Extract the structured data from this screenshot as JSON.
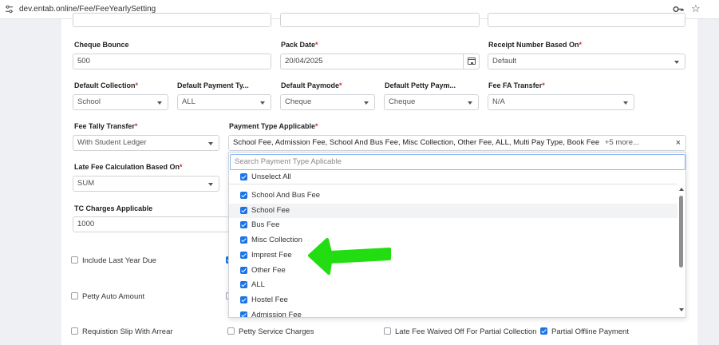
{
  "browser": {
    "url": "dev.entab.online/Fee/FeeYearlySetting"
  },
  "form": {
    "cheque_bounce": {
      "label": "Cheque Bounce",
      "value": "500"
    },
    "pack_date": {
      "label": "Pack Date",
      "req": "*",
      "value": "20/04/2025"
    },
    "receipt_number": {
      "label": "Receipt Number Based On",
      "req": "*",
      "value": "Default"
    },
    "default_collection": {
      "label": "Default Collection",
      "req": "*",
      "value": "School"
    },
    "default_payment_type": {
      "label": "Default Payment Ty...",
      "value": "ALL"
    },
    "default_paymode": {
      "label": "Default Paymode",
      "req": "*",
      "value": "Cheque"
    },
    "default_petty_paymode": {
      "label": "Default Petty Paym...",
      "value": "Cheque"
    },
    "fee_fa_transfer": {
      "label": "Fee FA Transfer",
      "req": "*",
      "value": "N/A"
    },
    "fee_tally_transfer": {
      "label": "Fee Tally Transfer",
      "req": "*",
      "value": "With Student Ledger"
    },
    "payment_type_applicable": {
      "label": "Payment Type Applicable",
      "req": "*",
      "value": "School Fee, Admission Fee, School And Bus Fee, Misc Collection, Other Fee, ALL, Multi Pay Type, Book Fee",
      "more": "+5 more...",
      "clear": "×"
    },
    "late_fee_calc": {
      "label": "Late Fee Calculation Based On",
      "req": "*",
      "value": "SUM"
    },
    "tc_charges": {
      "label": "TC Charges Applicable",
      "value": "1000"
    }
  },
  "dropdown": {
    "search_placeholder": "Search Payment Type Aplicable",
    "unselect_all": "Unselect All",
    "options": [
      "School And Bus Fee",
      "School Fee",
      "Bus Fee",
      "Misc Collection",
      "Imprest Fee",
      "Other Fee",
      "ALL",
      "Hostel Fee",
      "Admission Fee"
    ]
  },
  "checkboxes": {
    "include_last_year_due": "Include Last Year Due",
    "petty_auto_amount": "Petty Auto Amount",
    "requisition_slip": "Requistion Slip With Arrear",
    "petty_service_charges": "Petty Service Charges",
    "late_fee_waived": "Late Fee Waived Off For Partial Collection",
    "partial_offline_payment": "Partial Offline Payment"
  },
  "colors": {
    "accent": "#1a73e8",
    "required": "#d32f2f",
    "annotation_arrow": "#22dd11"
  }
}
